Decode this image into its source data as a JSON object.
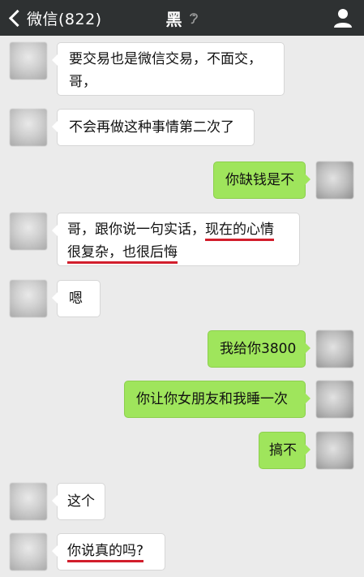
{
  "nav": {
    "back_label": "微信(822)",
    "title": "黑",
    "ear_icon": "ear-icon",
    "profile_icon": "person-icon"
  },
  "colors": {
    "nav_bg": "#2e3132",
    "chat_bg": "#ebebeb",
    "outgoing_bubble": "#9fe55c",
    "incoming_bubble": "#ffffff",
    "underline": "#d21e2c"
  },
  "messages": [
    {
      "side": "in",
      "lines": [
        "要交易也是微信交易，不面交，",
        "哥，"
      ]
    },
    {
      "side": "in",
      "lines": [
        "不会再做这种事情第二次了"
      ]
    },
    {
      "side": "out",
      "lines": [
        "你缺钱是不"
      ]
    },
    {
      "side": "in",
      "lines": [
        "哥，跟你说一句实话，现在的心情",
        "很复杂，也很后悔"
      ]
    },
    {
      "side": "in",
      "lines": [
        "嗯"
      ]
    },
    {
      "side": "out",
      "lines": [
        "我给你3800"
      ]
    },
    {
      "side": "out",
      "lines": [
        "你让你女朋友和我睡一次"
      ]
    },
    {
      "side": "out",
      "lines": [
        "搞不"
      ]
    },
    {
      "side": "in",
      "lines": [
        "这个"
      ]
    },
    {
      "side": "in",
      "lines": [
        "你说真的吗?"
      ]
    }
  ]
}
